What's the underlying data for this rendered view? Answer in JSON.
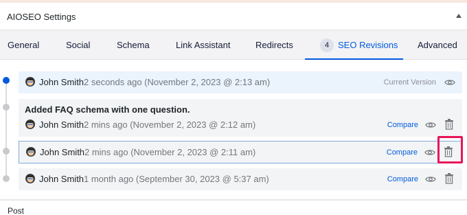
{
  "panel": {
    "title": "AIOSEO Settings"
  },
  "tabs": [
    {
      "label": "General"
    },
    {
      "label": "Social"
    },
    {
      "label": "Schema"
    },
    {
      "label": "Link Assistant"
    },
    {
      "label": "Redirects"
    },
    {
      "label": "SEO Revisions",
      "badge": "4",
      "active": true
    },
    {
      "label": "Advanced"
    }
  ],
  "revisions": [
    {
      "author": "John Smith",
      "time": "2 seconds ago (November 2, 2023 @ 2:13 am)",
      "status": "Current Version"
    },
    {
      "message": "Added FAQ schema with one question.",
      "author": "John Smith",
      "time": "2 mins ago (November 2, 2023 @ 2:12 am)",
      "compare": "Compare"
    },
    {
      "author": "John Smith",
      "time": "2 mins ago (November 2, 2023 @ 2:11 am)",
      "compare": "Compare"
    },
    {
      "author": "John Smith",
      "time": "1 month ago (September 30, 2023 @ 5:37 am)",
      "compare": "Compare"
    }
  ],
  "footer": {
    "label": "Post"
  },
  "colors": {
    "accent": "#005ae0",
    "highlight": "#e8145a",
    "muted": "#72777c"
  }
}
